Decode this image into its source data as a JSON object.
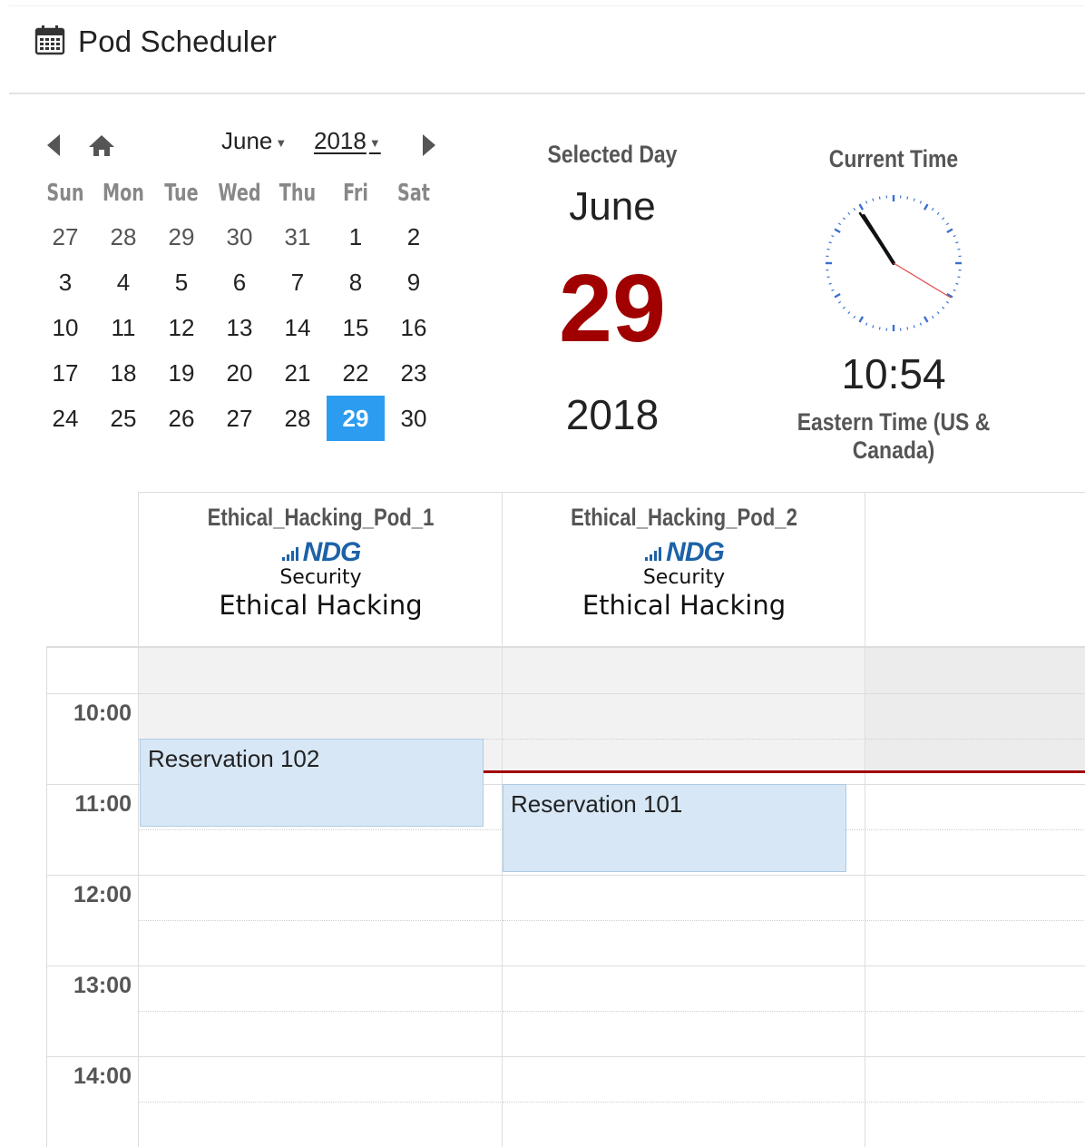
{
  "header": {
    "title": "Pod Scheduler",
    "icon": "calendar-icon"
  },
  "calendar": {
    "month": "June",
    "year": "2018",
    "weekdays": [
      "Sun",
      "Mon",
      "Tue",
      "Wed",
      "Thu",
      "Fri",
      "Sat"
    ],
    "weeks": [
      [
        "27",
        "28",
        "29",
        "30",
        "31",
        "1",
        "2"
      ],
      [
        "3",
        "4",
        "5",
        "6",
        "7",
        "8",
        "9"
      ],
      [
        "10",
        "11",
        "12",
        "13",
        "14",
        "15",
        "16"
      ],
      [
        "17",
        "18",
        "19",
        "20",
        "21",
        "22",
        "23"
      ],
      [
        "24",
        "25",
        "26",
        "27",
        "28",
        "29",
        "30"
      ]
    ],
    "selected_day": "29"
  },
  "selected": {
    "label": "Selected Day",
    "month": "June",
    "day": "29",
    "year": "2018"
  },
  "current_time": {
    "label": "Current Time",
    "time": "10:54",
    "timezone": "Eastern Time (US & Canada)"
  },
  "scheduler": {
    "resources": [
      {
        "name": "Ethical_Hacking_Pod_1",
        "logo": "NDG",
        "line1": "Security",
        "line2": "Ethical Hacking"
      },
      {
        "name": "Ethical_Hacking_Pod_2",
        "logo": "NDG",
        "line1": "Security",
        "line2": "Ethical Hacking"
      }
    ],
    "hours": [
      "10:00",
      "11:00",
      "12:00",
      "13:00",
      "14:00"
    ],
    "events": [
      {
        "title": "Reservation 102"
      },
      {
        "title": "Reservation 101"
      }
    ],
    "colors": {
      "now_line": "#a00000",
      "event_bg": "#d7e7f5",
      "selected_day_bg": "#2c9cf0"
    }
  }
}
